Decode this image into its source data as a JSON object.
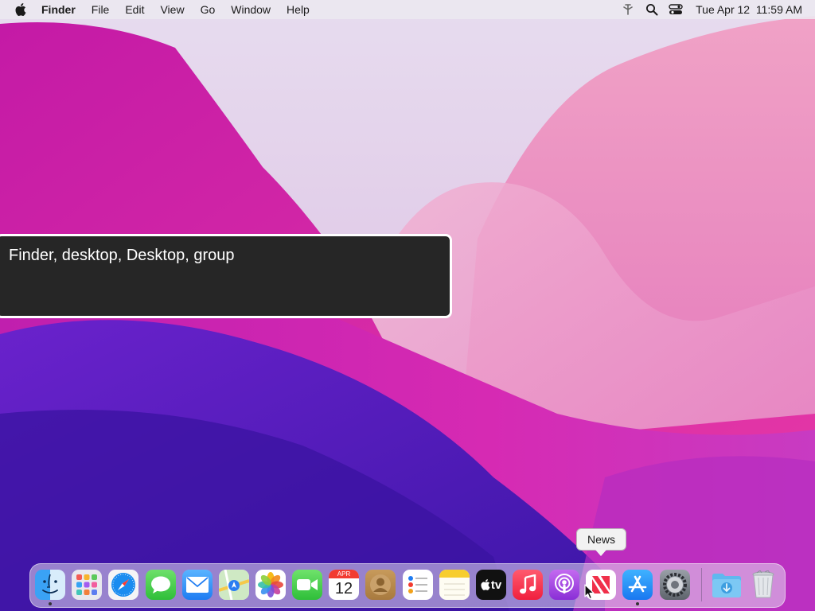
{
  "menubar": {
    "app_name": "Finder",
    "menus": [
      "File",
      "Edit",
      "View",
      "Go",
      "Window",
      "Help"
    ],
    "clock": "Tue Apr 12  11:59 AM"
  },
  "voiceover": {
    "caption": "Finder, desktop, Desktop, group"
  },
  "dock": {
    "tooltip": "News",
    "calendar": {
      "month": "APR",
      "day": "12"
    },
    "tv_label": "tv",
    "apps": [
      "Finder",
      "Launchpad",
      "Safari",
      "Messages",
      "Mail",
      "Maps",
      "Photos",
      "FaceTime",
      "Calendar",
      "Contacts",
      "Reminders",
      "Notes",
      "TV",
      "Music",
      "Podcasts",
      "News",
      "App Store",
      "System Preferences",
      "Downloads",
      "Trash"
    ]
  },
  "colors": {
    "accent": "#0a84ff",
    "wallpaper_magenta": "#d6189e",
    "wallpaper_violet": "#5a1fc0",
    "vo_panel": "#262626"
  }
}
